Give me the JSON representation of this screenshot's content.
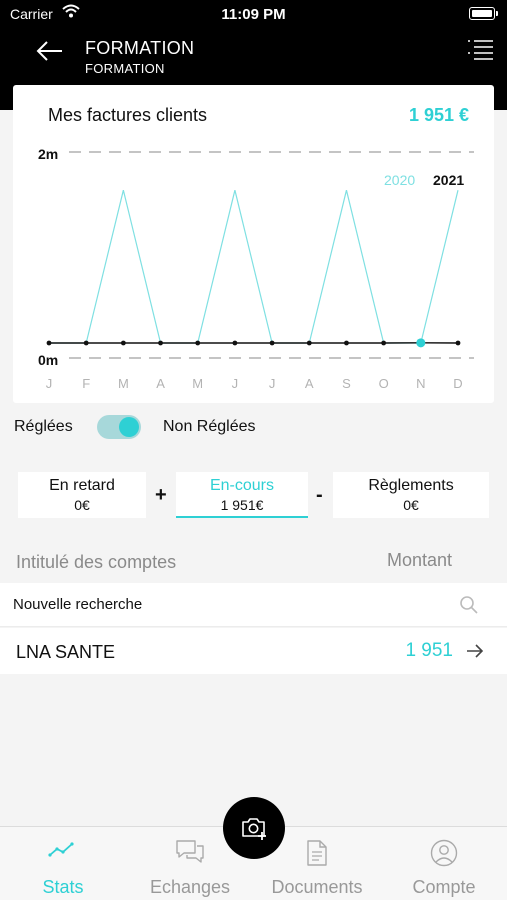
{
  "status_bar": {
    "carrier": "Carrier",
    "time": "11:09 PM"
  },
  "header": {
    "title": "FORMATION",
    "subtitle": "FORMATION"
  },
  "card": {
    "title": "Mes factures clients",
    "amount": "1 951 €",
    "y_top_label": "2m",
    "y_bottom_label": "0m",
    "legend": [
      "2020",
      "2021"
    ]
  },
  "chart_data": {
    "type": "line",
    "categories": [
      "J",
      "F",
      "M",
      "A",
      "M",
      "J",
      "J",
      "A",
      "S",
      "O",
      "N",
      "D"
    ],
    "ylim": [
      0,
      2000000
    ],
    "series": [
      {
        "name": "2020",
        "color": "#7fe0e2",
        "values": [
          0,
          0,
          1600000,
          0,
          0,
          1600000,
          0,
          0,
          1600000,
          0,
          0,
          1600000
        ]
      },
      {
        "name": "2021",
        "color": "#111111",
        "values": [
          0,
          0,
          0,
          0,
          0,
          0,
          0,
          0,
          0,
          0,
          1951,
          0
        ]
      }
    ],
    "highlight": {
      "series": "2021",
      "category_index": 10,
      "color": "#2ed0d4"
    }
  },
  "filter": {
    "left_label": "Réglées",
    "right_label": "Non Réglées",
    "toggle_on": true
  },
  "tiles": [
    {
      "label": "En retard",
      "value": "0€"
    },
    {
      "label": "En-cours",
      "value": "1 951€"
    },
    {
      "label": "Règlements",
      "value": "0€"
    }
  ],
  "operators": {
    "plus": "+",
    "minus": "-"
  },
  "list": {
    "col_account": "Intitulé des comptes",
    "col_amount": "Montant",
    "search_placeholder": "Nouvelle recherche",
    "rows": [
      {
        "name": "LNA SANTE",
        "amount": "1 951"
      }
    ]
  },
  "tabs": [
    {
      "label": "Stats",
      "icon": "stats-icon"
    },
    {
      "label": "Echanges",
      "icon": "chat-icon"
    },
    {
      "label": "Documents",
      "icon": "document-icon"
    },
    {
      "label": "Compte",
      "icon": "user-icon"
    }
  ],
  "colors": {
    "accent": "#2ed0d4",
    "header_bg": "#000000"
  }
}
